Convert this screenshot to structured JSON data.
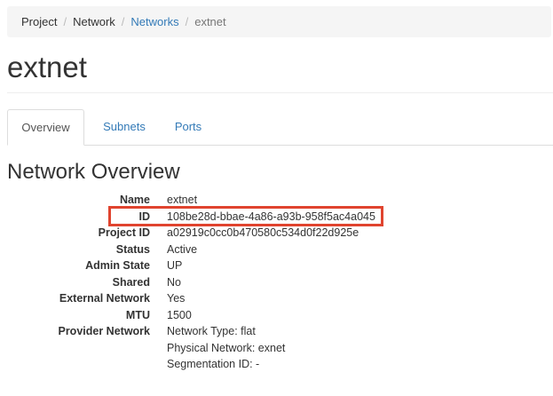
{
  "breadcrumb": {
    "items": [
      "Project",
      "Network",
      "Networks",
      "extnet"
    ]
  },
  "page_title": "extnet",
  "tabs": [
    {
      "label": "Overview"
    },
    {
      "label": "Subnets"
    },
    {
      "label": "Ports"
    }
  ],
  "section_title": "Network Overview",
  "details": {
    "name": {
      "label": "Name",
      "value": "extnet"
    },
    "id": {
      "label": "ID",
      "value": "108be28d-bbae-4a86-a93b-958f5ac4a045"
    },
    "project_id": {
      "label": "Project ID",
      "value": "a02919c0cc0b470580c534d0f22d925e"
    },
    "status": {
      "label": "Status",
      "value": "Active"
    },
    "admin_state": {
      "label": "Admin State",
      "value": "UP"
    },
    "shared": {
      "label": "Shared",
      "value": "No"
    },
    "external_network": {
      "label": "External Network",
      "value": "Yes"
    },
    "mtu": {
      "label": "MTU",
      "value": "1500"
    },
    "provider_network": {
      "label": "Provider Network",
      "lines": [
        "Network Type: flat",
        "Physical Network: exnet",
        "Segmentation ID: -"
      ]
    }
  },
  "colors": {
    "link": "#337ab7",
    "highlight": "#e0442f"
  }
}
